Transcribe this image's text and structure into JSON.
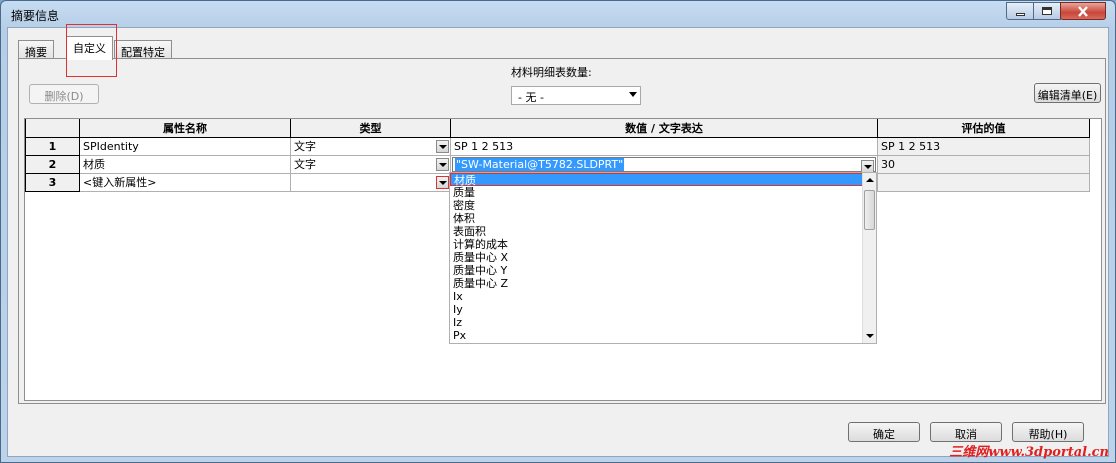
{
  "window": {
    "title": "摘要信息",
    "min_icon": "minimize-icon",
    "max_icon": "maximize-icon",
    "close_icon": "close-icon"
  },
  "tabs": [
    {
      "label": "摘要"
    },
    {
      "label": "自定义"
    },
    {
      "label": "配置特定"
    }
  ],
  "toolbar": {
    "delete_label": "删除(D)",
    "bom_qty_label": "材料明细表数量:",
    "bom_qty_value": "- 无 -",
    "edit_list_label": "编辑清单(E)"
  },
  "grid": {
    "headers": [
      "",
      "属性名称",
      "类型",
      "数值 / 文字表达",
      "评估的值"
    ],
    "rows": [
      {
        "num": "1",
        "name": "SPIdentity",
        "type": "文字",
        "value": "SP 1 2 513",
        "evaluated": "SP 1 2 513"
      },
      {
        "num": "2",
        "name": "材质",
        "type": "文字",
        "value": "\"SW-Material@T5782.SLDPRT\"",
        "evaluated": "30"
      },
      {
        "num": "3",
        "name": "<键入新属性>",
        "type": "",
        "value": "",
        "evaluated": ""
      }
    ]
  },
  "dropdown": {
    "items": [
      "材质",
      "质量",
      "密度",
      "体积",
      "表面积",
      "计算的成本",
      "质量中心 X",
      "质量中心 Y",
      "质量中心 Z",
      "Ix",
      "Iy",
      "Iz",
      "Px"
    ],
    "selected_index": 0
  },
  "footer": {
    "ok_label": "确定",
    "cancel_label": "取消",
    "help_label": "帮助(H)"
  },
  "watermark": "三维网www.3dportal.cn",
  "colors": {
    "selection": "#3399ff",
    "highlight_box": "#e03030",
    "titlebar": "#c6dcf2"
  }
}
